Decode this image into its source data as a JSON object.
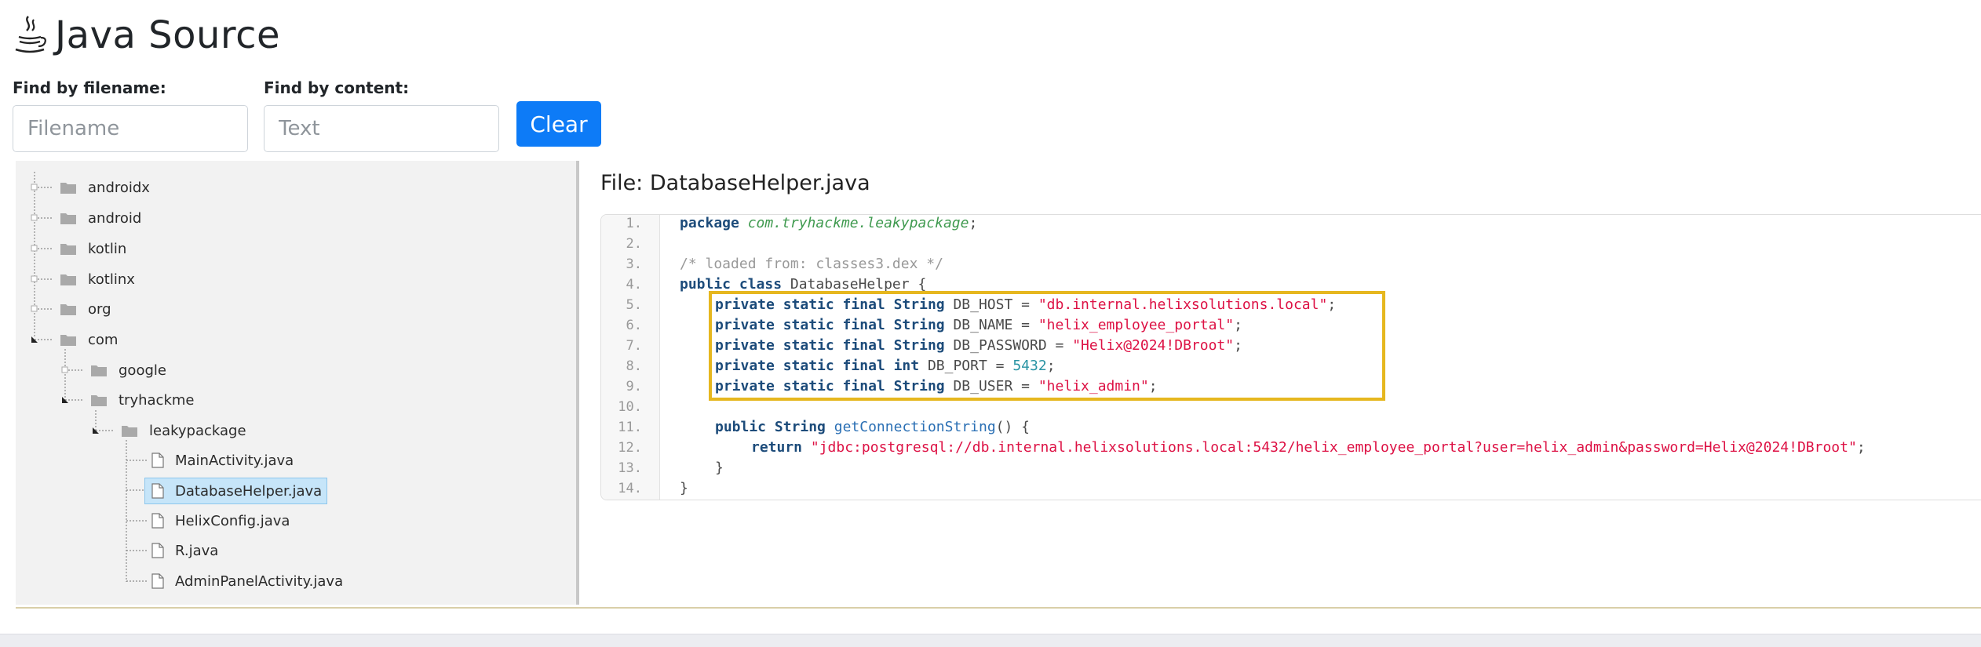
{
  "header": {
    "title": "Java Source",
    "icon": "java-coffee-icon"
  },
  "search": {
    "filename_label": "Find by filename:",
    "filename_placeholder": "Filename",
    "content_label": "Find by content:",
    "content_placeholder": "Text",
    "clear_label": "Clear"
  },
  "tree": {
    "nodes": [
      {
        "label": "androidx",
        "type": "folder"
      },
      {
        "label": "android",
        "type": "folder"
      },
      {
        "label": "kotlin",
        "type": "folder"
      },
      {
        "label": "kotlinx",
        "type": "folder"
      },
      {
        "label": "org",
        "type": "folder"
      },
      {
        "label": "com",
        "type": "folder",
        "expanded": true
      },
      {
        "label": "google",
        "type": "folder"
      },
      {
        "label": "tryhackme",
        "type": "folder",
        "expanded": true
      },
      {
        "label": "leakypackage",
        "type": "folder",
        "expanded": true
      },
      {
        "label": "MainActivity.java",
        "type": "file"
      },
      {
        "label": "DatabaseHelper.java",
        "type": "file",
        "selected": true
      },
      {
        "label": "HelixConfig.java",
        "type": "file"
      },
      {
        "label": "R.java",
        "type": "file"
      },
      {
        "label": "AdminPanelActivity.java",
        "type": "file"
      }
    ]
  },
  "viewer": {
    "file_title": "File: DatabaseHelper.java",
    "line_numbers": [
      "1.",
      "2.",
      "3.",
      "4.",
      "5.",
      "6.",
      "7.",
      "8.",
      "9.",
      "10.",
      "11.",
      "12.",
      "13.",
      "14."
    ],
    "code": {
      "l1_kw": "package",
      "l1_pkg": "com.tryhackme.leakypackage",
      "l1_end": ";",
      "l3_comment": "/* loaded from: classes3.dex */",
      "l4_kw": "public class",
      "l4_rest": " DatabaseHelper {",
      "field_mods": "private static final",
      "type_string": "String",
      "type_int": "int",
      "l5_name": " DB_HOST = ",
      "l5_val": "\"db.internal.helixsolutions.local\"",
      "l6_name": " DB_NAME = ",
      "l6_val": "\"helix_employee_portal\"",
      "l7_name": " DB_PASSWORD = ",
      "l7_val": "\"Helix@2024!DBroot\"",
      "l8_name": " DB_PORT = ",
      "l8_val": "5432",
      "l9_name": " DB_USER = ",
      "l9_val": "\"helix_admin\"",
      "semicolon": ";",
      "l11_kw": "public",
      "l11_type": "String",
      "l11_method": "getConnectionString",
      "l11_rest": "() {",
      "l12_kw": "return",
      "l12_val": "\"jdbc:postgresql://db.internal.helixsolutions.local:5432/helix_employee_portal?user=helix_admin&password=Helix@2024!DBroot\"",
      "l13": "}",
      "l14": "}"
    }
  },
  "colors": {
    "accent": "#0d7bf7",
    "highlight": "#e6b71f",
    "selected_bg": "#c6e5f9"
  }
}
